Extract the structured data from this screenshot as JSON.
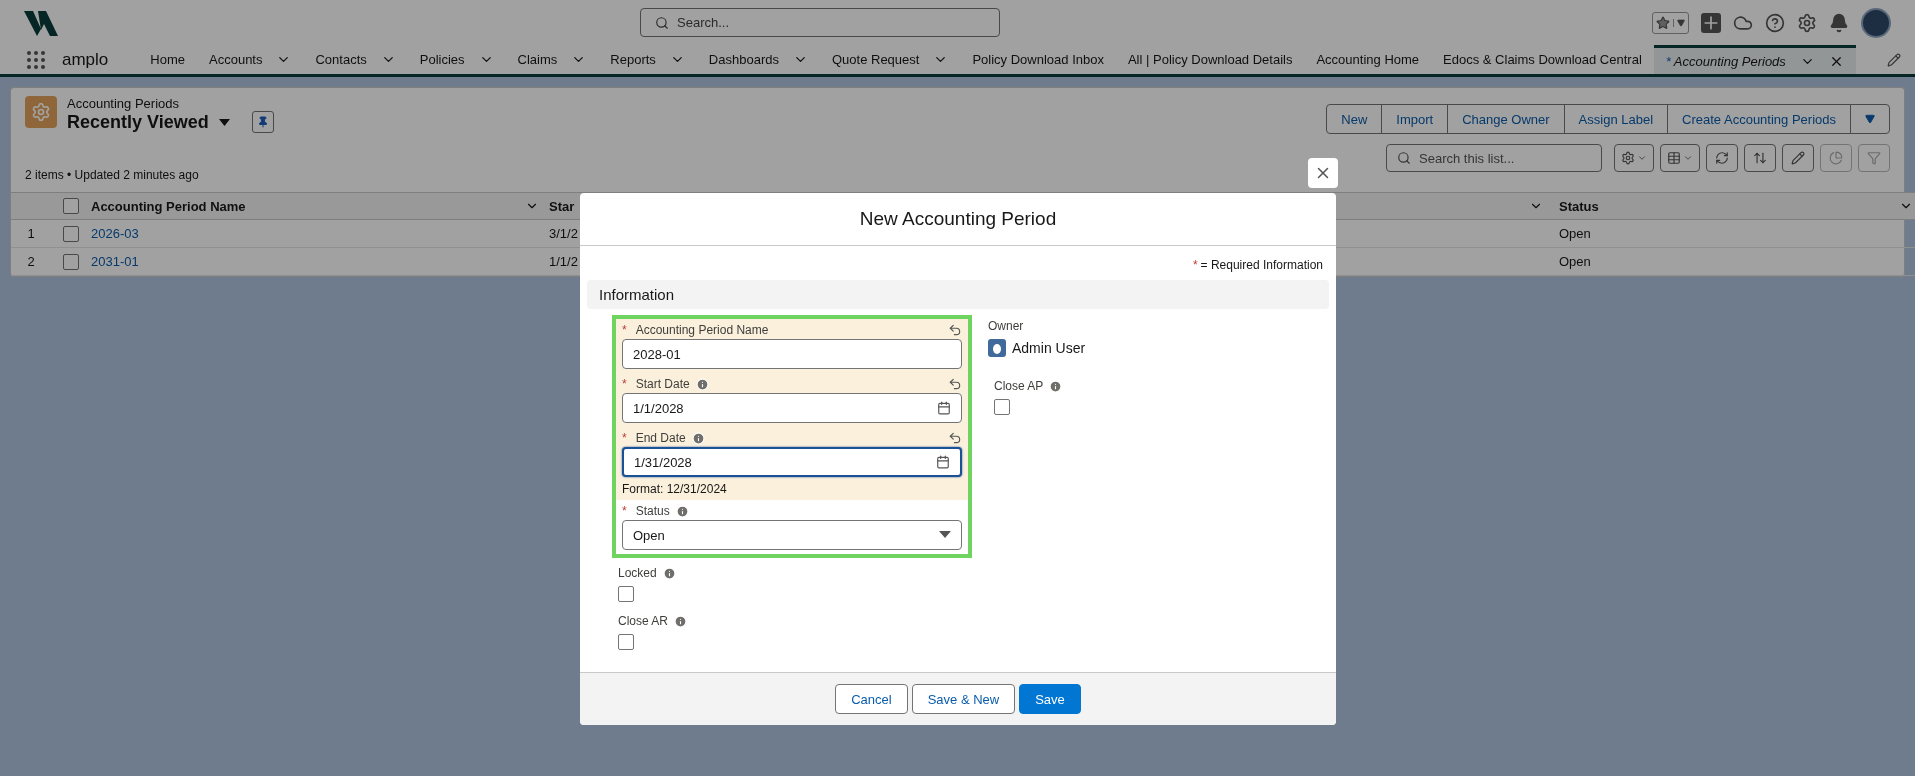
{
  "app_bar": {
    "search_placeholder": "Search..."
  },
  "nav": {
    "app_name": "amplo",
    "items": [
      {
        "label": "Home",
        "has_menu": false,
        "selected": false
      },
      {
        "label": "Accounts",
        "has_menu": true,
        "selected": false
      },
      {
        "label": "Contacts",
        "has_menu": true,
        "selected": false
      },
      {
        "label": "Policies",
        "has_menu": true,
        "selected": false
      },
      {
        "label": "Claims",
        "has_menu": true,
        "selected": false
      },
      {
        "label": "Reports",
        "has_menu": true,
        "selected": false
      },
      {
        "label": "Dashboards",
        "has_menu": true,
        "selected": false
      },
      {
        "label": "Quote Request",
        "has_menu": true,
        "selected": false
      },
      {
        "label": "Policy Download Inbox",
        "has_menu": false,
        "selected": false
      },
      {
        "label": "All | Policy Download Details",
        "has_menu": false,
        "selected": false
      },
      {
        "label": "Accounting Home",
        "has_menu": false,
        "selected": false
      },
      {
        "label": "Edocs & Claims Download Central",
        "has_menu": false,
        "selected": false
      },
      {
        "label": "Accounting Periods",
        "marker": "*",
        "has_menu": true,
        "selected": true
      }
    ]
  },
  "list": {
    "object_label": "Accounting Periods",
    "view_name": "Recently Viewed",
    "summary": "2 items • Updated 2 minutes ago",
    "actions": [
      "New",
      "Import",
      "Change Owner",
      "Assign Label",
      "Create Accounting Periods"
    ],
    "search_placeholder": "Search this list...",
    "all_selected": false,
    "columns": {
      "name": "Accounting Period Name",
      "start": "Star",
      "status": "Status"
    },
    "rows": [
      {
        "number": "1",
        "name": "2026-03",
        "start": "3/1/2",
        "status": "Open",
        "selected": false
      },
      {
        "number": "2",
        "name": "2031-01",
        "start": "1/1/2",
        "status": "Open",
        "selected": false
      }
    ]
  },
  "modal": {
    "title": "New Accounting Period",
    "required_marker": "*",
    "required_note": "= Required Information",
    "section": "Information",
    "left_fields": [
      {
        "kind": "text",
        "label": "Accounting Period Name",
        "required": true,
        "info": false,
        "changed": true,
        "highlighted": true,
        "focused": false,
        "value": "2028-01"
      },
      {
        "kind": "date",
        "label": "Start Date",
        "required": true,
        "info": true,
        "changed": true,
        "highlighted": true,
        "focused": false,
        "value": "1/1/2028"
      },
      {
        "kind": "date",
        "label": "End Date",
        "required": true,
        "info": true,
        "changed": true,
        "highlighted": true,
        "focused": true,
        "value": "1/31/2028",
        "hint": "Format: 12/31/2024"
      },
      {
        "kind": "picklist",
        "label": "Status",
        "required": true,
        "info": true,
        "changed": false,
        "highlighted": true,
        "focused": false,
        "value": "Open"
      },
      {
        "kind": "checkbox",
        "label": "Locked",
        "required": false,
        "info": true,
        "changed": false,
        "highlighted": false,
        "checked": false
      },
      {
        "kind": "checkbox",
        "label": "Close AR",
        "required": false,
        "info": true,
        "changed": false,
        "highlighted": false,
        "checked": false
      }
    ],
    "owner": {
      "label": "Owner",
      "value": "Admin User"
    },
    "right_fields": [
      {
        "kind": "checkbox",
        "label": "Close AP",
        "required": false,
        "info": true,
        "changed": false,
        "highlighted": false,
        "checked": false
      }
    ],
    "buttons": [
      {
        "label": "Cancel",
        "kind": "neutral"
      },
      {
        "label": "Save & New",
        "kind": "neutral"
      },
      {
        "label": "Save",
        "kind": "brand"
      }
    ]
  }
}
